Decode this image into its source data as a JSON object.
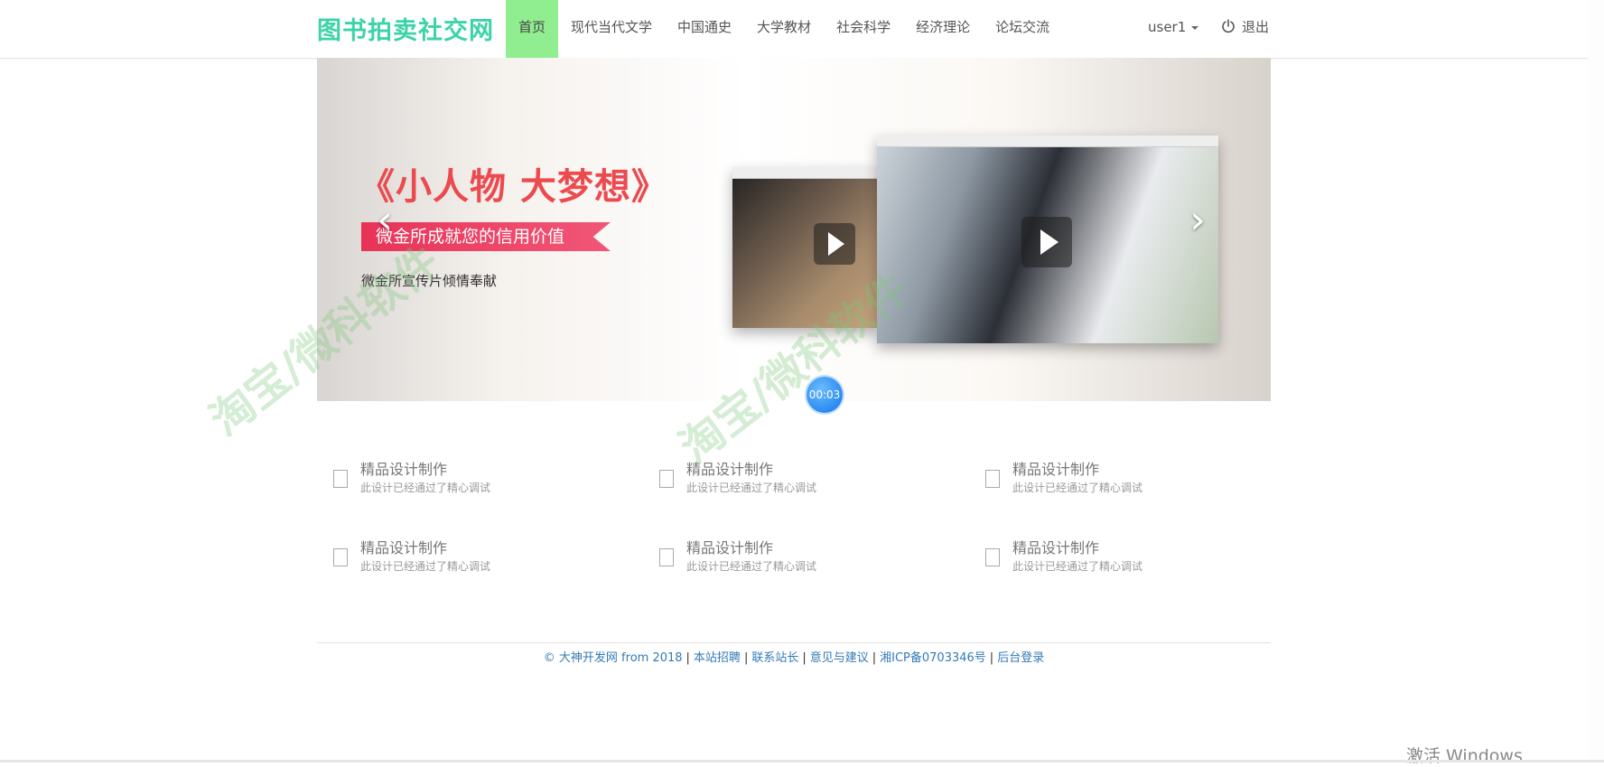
{
  "nav": {
    "brand": "图书拍卖社交网",
    "items": [
      {
        "label": "首页",
        "active": true
      },
      {
        "label": "现代当代文学",
        "active": false
      },
      {
        "label": "中国通史",
        "active": false
      },
      {
        "label": "大学教材",
        "active": false
      },
      {
        "label": "社会科学",
        "active": false
      },
      {
        "label": "经济理论",
        "active": false
      },
      {
        "label": "论坛交流",
        "active": false
      }
    ],
    "user": "user1",
    "logout": "退出",
    "active_color": "#90ee90",
    "brand_color": "#3dd3a8"
  },
  "carousel": {
    "title": "《小人物 大梦想》",
    "ribbon": "微金所成就您的信用价值",
    "caption": "微金所宣传片倾情奉献",
    "prev_icon": "‹",
    "next_icon": "›",
    "timer": "00:03",
    "watermark": "淘宝/微科软件"
  },
  "features": [
    {
      "title": "精品设计制作",
      "desc": "此设计已经通过了精心调试"
    },
    {
      "title": "精品设计制作",
      "desc": "此设计已经通过了精心调试"
    },
    {
      "title": "精品设计制作",
      "desc": "此设计已经通过了精心调试"
    },
    {
      "title": "精品设计制作",
      "desc": "此设计已经通过了精心调试"
    },
    {
      "title": "精品设计制作",
      "desc": "此设计已经通过了精心调试"
    },
    {
      "title": "精品设计制作",
      "desc": "此设计已经通过了精心调试"
    }
  ],
  "footer": {
    "copyright": "© 大神开发网 from 2018",
    "links": [
      "本站招聘",
      "联系站长",
      "意见与建议",
      "湘ICP备0703346号",
      "后台登录"
    ],
    "separator": "|",
    "link_color": "#337ab7"
  },
  "os_overlay": "激活 Windows"
}
